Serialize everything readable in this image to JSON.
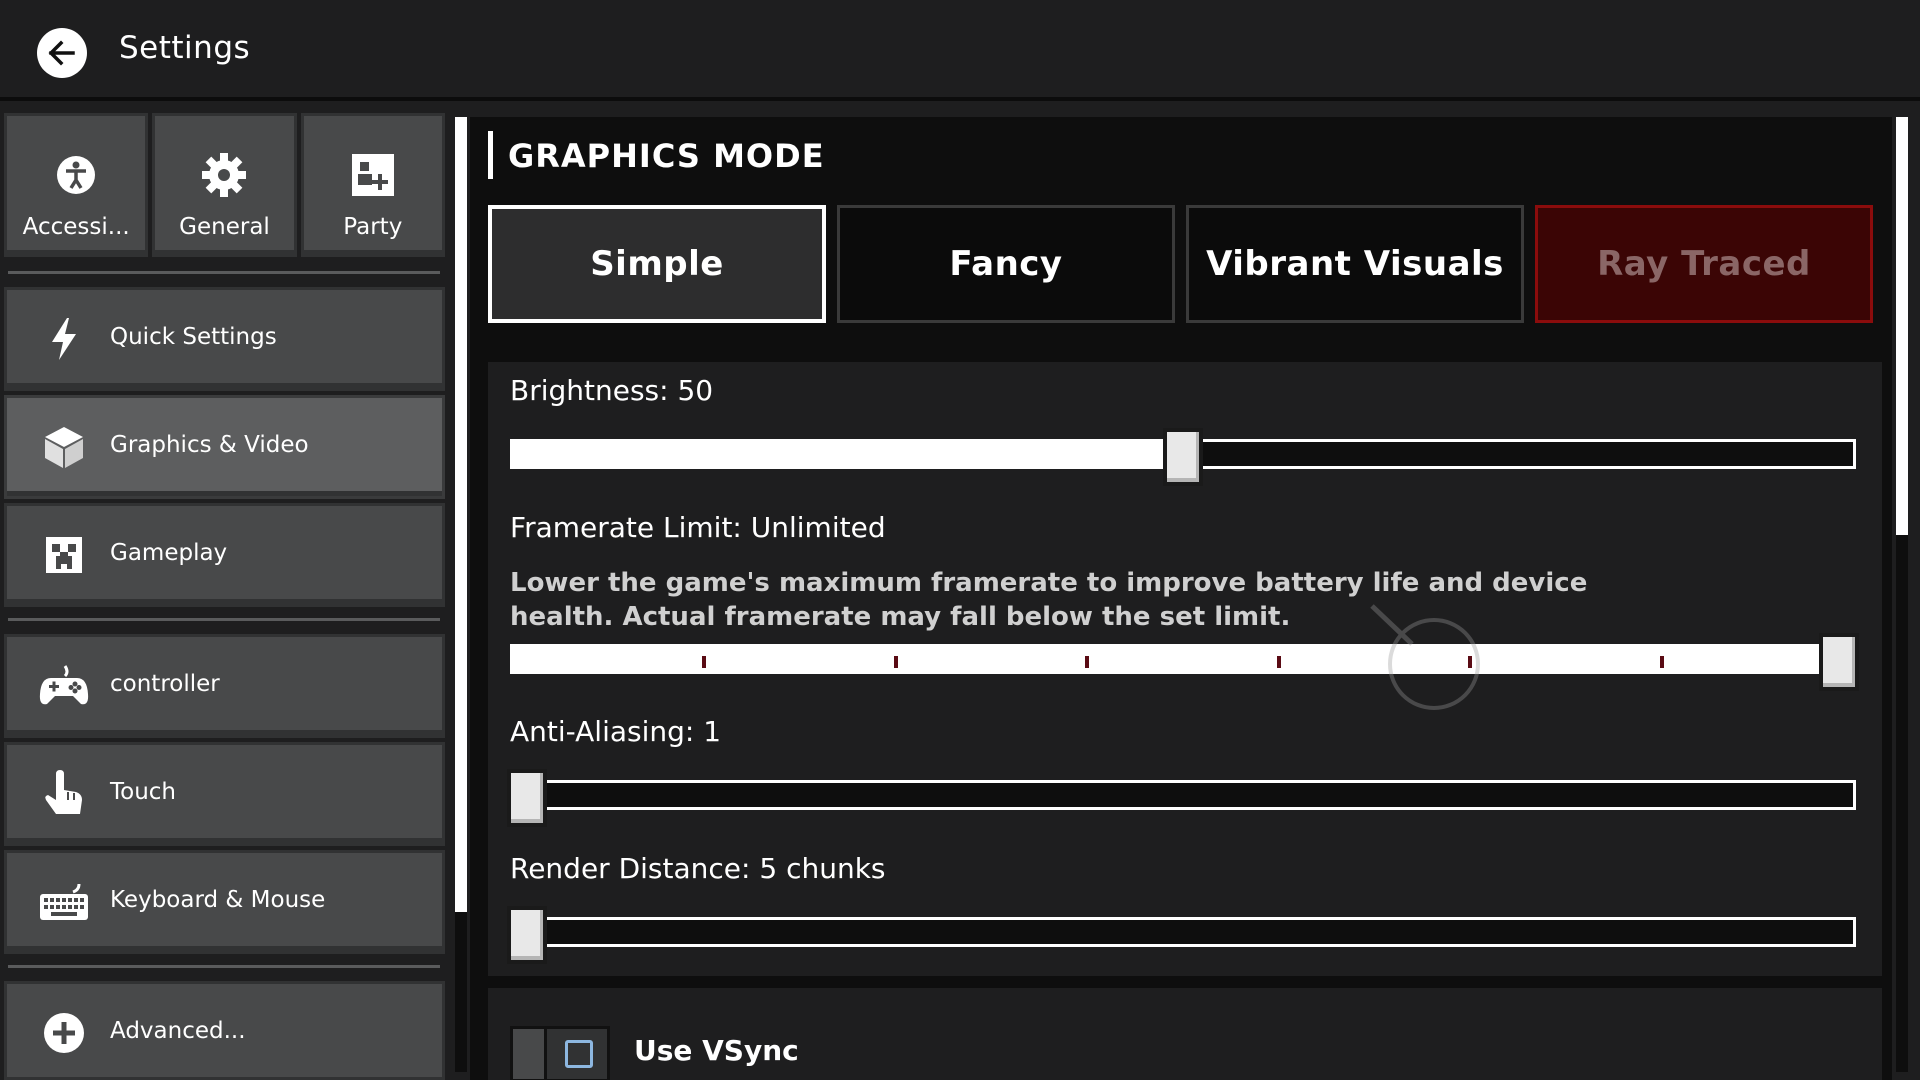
{
  "header": {
    "title": "Settings",
    "back_icon": "arrow-left-icon"
  },
  "sidebar": {
    "top_tabs": [
      {
        "label": "Accessi...",
        "icon": "accessibility-icon"
      },
      {
        "label": "General",
        "icon": "gear-icon"
      },
      {
        "label": "Party",
        "icon": "party-icon"
      }
    ],
    "items": [
      {
        "label": "Quick Settings",
        "icon": "lightning-icon"
      },
      {
        "label": "Graphics & Video",
        "icon": "cube-icon",
        "active": true
      },
      {
        "label": "Gameplay",
        "icon": "creeper-icon"
      },
      {
        "label": "controller",
        "icon": "gamepad-icon"
      },
      {
        "label": "Touch",
        "icon": "touch-hand-icon"
      },
      {
        "label": "Keyboard & Mouse",
        "icon": "keyboard-icon"
      },
      {
        "label": "Advanced...",
        "icon": "plus-circle-icon"
      }
    ]
  },
  "content": {
    "section_title": "GRAPHICS MODE",
    "modes": [
      {
        "label": "Simple",
        "selected": true
      },
      {
        "label": "Fancy",
        "selected": false
      },
      {
        "label": "Vibrant Visuals",
        "selected": false
      },
      {
        "label": "Ray Traced",
        "selected": false,
        "disabled": true
      }
    ],
    "brightness": {
      "label": "Brightness: 50",
      "value": 50,
      "min": 0,
      "max": 100
    },
    "framerate": {
      "label": "Framerate Limit: Unlimited",
      "description": "Lower the game's maximum framerate to improve battery life and device health. Actual framerate may fall below the set limit.",
      "position": 1.0,
      "tick_count": 6
    },
    "anti_aliasing": {
      "label": "Anti-Aliasing: 1",
      "position": 0.0
    },
    "render_distance": {
      "label": "Render Distance: 5 chunks",
      "position": 0.0
    },
    "vsync": {
      "label": "Use VSync",
      "enabled": false
    }
  },
  "colors": {
    "background": "#1e1e1f",
    "panel": "#1e1e1f",
    "content_bg": "#0e0e0e",
    "button": "#48494a",
    "ray_traced_bg": "#3b0505",
    "ray_traced_border": "#8b0c0c",
    "tick": "#5a0b14"
  }
}
